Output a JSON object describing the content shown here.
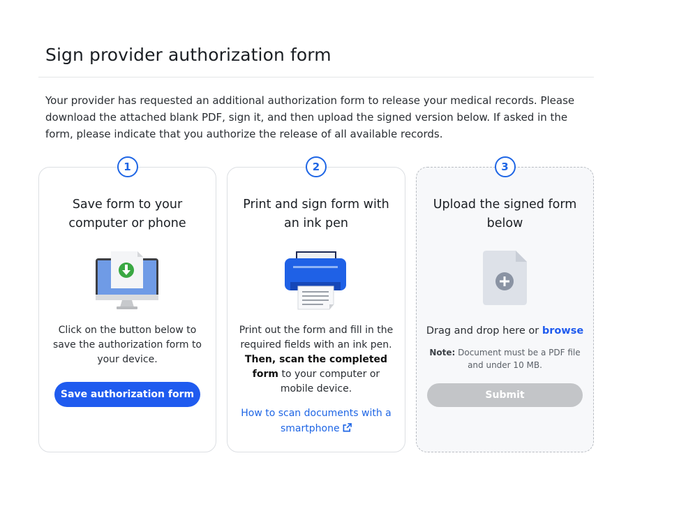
{
  "page": {
    "title": "Sign provider authorization form",
    "intro": "Your provider has requested an additional authorization form to release your medical records. Please download the attached blank PDF, sign it, and then upload the signed version below. If asked in the form, please indicate that you authorize the release of all available records."
  },
  "steps": [
    {
      "number": "1",
      "title": "Save form to your computer or phone",
      "illustration": "computer-download-icon",
      "description": "Click on the button below to save the authorization form to your device.",
      "button_label": "Save authorization form"
    },
    {
      "number": "2",
      "title": "Print and sign form with an ink pen",
      "illustration": "printer-icon",
      "description_pre": "Print out the form and fill in the required fields with an ink pen. ",
      "description_bold": "Then, scan the completed form",
      "description_post": " to your computer or mobile device.",
      "link_label": "How to scan documents with a smartphone",
      "link_icon": "external-link-icon"
    },
    {
      "number": "3",
      "title": "Upload the signed form below",
      "illustration": "add-document-icon",
      "drag_text": "Drag and drop here or ",
      "browse_label": "browse",
      "note_label": "Note:",
      "note_text": " Document must be a PDF file and under 10 MB.",
      "submit_label": "Submit"
    }
  ],
  "colors": {
    "accent": "#1f5bef",
    "step_border": "#1f66e5",
    "disabled": "#c3c5c8",
    "download_green": "#3aa843"
  }
}
